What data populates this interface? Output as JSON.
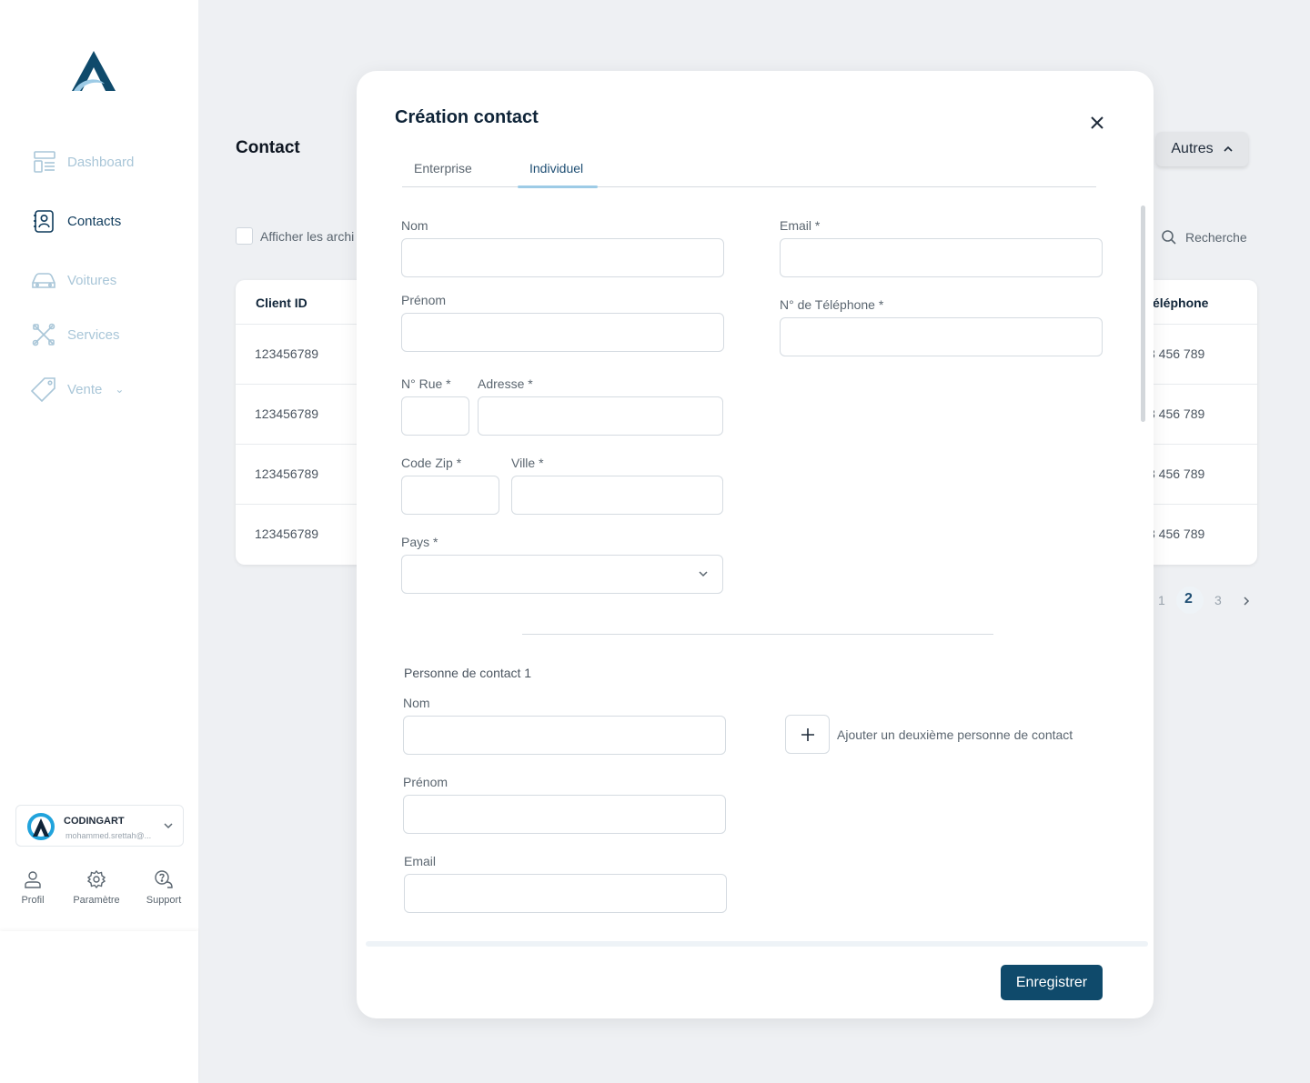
{
  "sidebar": {
    "items": [
      {
        "label": "Dashboard",
        "icon": "dashboard-icon"
      },
      {
        "label": "Contacts",
        "icon": "contacts-icon"
      },
      {
        "label": "Voitures",
        "icon": "car-icon"
      },
      {
        "label": "Services",
        "icon": "tools-icon"
      },
      {
        "label": "Vente",
        "icon": "tag-icon"
      }
    ],
    "account": {
      "name": "CODINGART",
      "email": "mohammed.srettah@..."
    },
    "bottom_links": {
      "profile": "Profil",
      "settings": "Paramètre",
      "support": "Support"
    }
  },
  "page": {
    "title": "Contact",
    "archive_label": "Afficher les archi",
    "others_button": "Autres",
    "search_label": "Recherche",
    "table": {
      "headers": {
        "client_id": "Client ID",
        "phone": "éléphone"
      },
      "rows": [
        {
          "client_id": "123456789",
          "phone": "3 456 789"
        },
        {
          "client_id": "123456789",
          "phone": "3 456 789"
        },
        {
          "client_id": "123456789",
          "phone": "3 456 789"
        },
        {
          "client_id": "123456789",
          "phone": "3 456 789"
        }
      ]
    },
    "pagination": {
      "pages": [
        "1",
        "2",
        "3"
      ],
      "current": "2"
    }
  },
  "modal": {
    "title": "Création contact",
    "tabs": {
      "enterprise": "Enterprise",
      "individual": "Individuel"
    },
    "fields": {
      "nom": {
        "label": "Nom",
        "value": ""
      },
      "prenom": {
        "label": "Prénom",
        "value": ""
      },
      "rue": {
        "label": "N° Rue *",
        "value": ""
      },
      "adresse": {
        "label": "Adresse *",
        "value": ""
      },
      "zip": {
        "label": "Code Zip *",
        "value": ""
      },
      "ville": {
        "label": "Ville *",
        "value": ""
      },
      "pays": {
        "label": "Pays *",
        "value": ""
      },
      "email": {
        "label": "Email *",
        "value": ""
      },
      "telephone": {
        "label": "N° de Téléphone *",
        "value": ""
      }
    },
    "contact_person": {
      "section_title": "Personne de contact  1",
      "nom": {
        "label": "Nom",
        "value": ""
      },
      "prenom": {
        "label": "Prénom",
        "value": ""
      },
      "email": {
        "label": "Email",
        "value": ""
      },
      "add_label": "Ajouter  un deuxième personne de contact"
    },
    "save_button": "Enregistrer"
  },
  "colors": {
    "primary": "#0f4a6b",
    "accent_light": "#9dcbe6",
    "inactive_nav": "#a9c6d8"
  }
}
